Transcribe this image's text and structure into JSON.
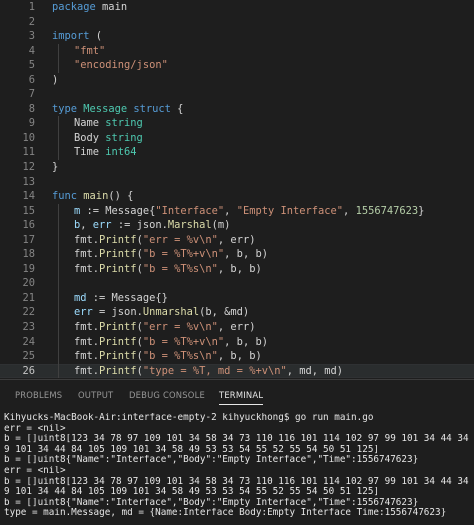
{
  "editor": {
    "current_line": 26,
    "lines": [
      {
        "num": "1",
        "indent": 0,
        "tokens": [
          [
            "keyword",
            "package"
          ],
          [
            "plain",
            " main"
          ]
        ]
      },
      {
        "num": "2",
        "indent": 0,
        "tokens": []
      },
      {
        "num": "3",
        "indent": 0,
        "tokens": [
          [
            "keyword",
            "import"
          ],
          [
            "plain",
            " ("
          ]
        ]
      },
      {
        "num": "4",
        "indent": 1,
        "tokens": [
          [
            "string",
            "\"fmt\""
          ]
        ]
      },
      {
        "num": "5",
        "indent": 1,
        "tokens": [
          [
            "string",
            "\"encoding/json\""
          ]
        ]
      },
      {
        "num": "6",
        "indent": 0,
        "tokens": [
          [
            "plain",
            ")"
          ]
        ]
      },
      {
        "num": "7",
        "indent": 0,
        "tokens": []
      },
      {
        "num": "8",
        "indent": 0,
        "tokens": [
          [
            "keyword",
            "type"
          ],
          [
            "plain",
            " "
          ],
          [
            "type",
            "Message"
          ],
          [
            "plain",
            " "
          ],
          [
            "keyword",
            "struct"
          ],
          [
            "plain",
            " {"
          ]
        ]
      },
      {
        "num": "9",
        "indent": 1,
        "tokens": [
          [
            "plain",
            "Name "
          ],
          [
            "type",
            "string"
          ]
        ]
      },
      {
        "num": "10",
        "indent": 1,
        "tokens": [
          [
            "plain",
            "Body "
          ],
          [
            "type",
            "string"
          ]
        ]
      },
      {
        "num": "11",
        "indent": 1,
        "tokens": [
          [
            "plain",
            "Time "
          ],
          [
            "type",
            "int64"
          ]
        ]
      },
      {
        "num": "12",
        "indent": 0,
        "tokens": [
          [
            "plain",
            "}"
          ]
        ]
      },
      {
        "num": "13",
        "indent": 0,
        "tokens": []
      },
      {
        "num": "14",
        "indent": 0,
        "tokens": [
          [
            "keyword",
            "func"
          ],
          [
            "plain",
            " "
          ],
          [
            "func",
            "main"
          ],
          [
            "plain",
            "() {"
          ]
        ]
      },
      {
        "num": "15",
        "indent": 1,
        "tokens": [
          [
            "var",
            "m"
          ],
          [
            "plain",
            " := Message{"
          ],
          [
            "string",
            "\"Interface\""
          ],
          [
            "plain",
            ", "
          ],
          [
            "string",
            "\"Empty Interface\""
          ],
          [
            "plain",
            ", "
          ],
          [
            "number",
            "1556747623"
          ],
          [
            "plain",
            "}"
          ]
        ]
      },
      {
        "num": "16",
        "indent": 1,
        "tokens": [
          [
            "var",
            "b"
          ],
          [
            "plain",
            ", "
          ],
          [
            "var",
            "err"
          ],
          [
            "plain",
            " := json."
          ],
          [
            "func",
            "Marshal"
          ],
          [
            "plain",
            "(m)"
          ]
        ]
      },
      {
        "num": "17",
        "indent": 1,
        "tokens": [
          [
            "plain",
            "fmt."
          ],
          [
            "func",
            "Printf"
          ],
          [
            "plain",
            "("
          ],
          [
            "string",
            "\"err = %v\\n\""
          ],
          [
            "plain",
            ", err)"
          ]
        ]
      },
      {
        "num": "18",
        "indent": 1,
        "tokens": [
          [
            "plain",
            "fmt."
          ],
          [
            "func",
            "Printf"
          ],
          [
            "plain",
            "("
          ],
          [
            "string",
            "\"b = %T%+v\\n\""
          ],
          [
            "plain",
            ", b, b)"
          ]
        ]
      },
      {
        "num": "19",
        "indent": 1,
        "tokens": [
          [
            "plain",
            "fmt."
          ],
          [
            "func",
            "Printf"
          ],
          [
            "plain",
            "("
          ],
          [
            "string",
            "\"b = %T%s\\n\""
          ],
          [
            "plain",
            ", b, b)"
          ]
        ]
      },
      {
        "num": "20",
        "indent": 1,
        "tokens": []
      },
      {
        "num": "21",
        "indent": 1,
        "tokens": [
          [
            "var",
            "md"
          ],
          [
            "plain",
            " := Message{}"
          ]
        ]
      },
      {
        "num": "22",
        "indent": 1,
        "tokens": [
          [
            "var",
            "err"
          ],
          [
            "plain",
            " = json."
          ],
          [
            "func",
            "Unmarshal"
          ],
          [
            "plain",
            "(b, &md)"
          ]
        ]
      },
      {
        "num": "23",
        "indent": 1,
        "tokens": [
          [
            "plain",
            "fmt."
          ],
          [
            "func",
            "Printf"
          ],
          [
            "plain",
            "("
          ],
          [
            "string",
            "\"err = %v\\n\""
          ],
          [
            "plain",
            ", err)"
          ]
        ]
      },
      {
        "num": "24",
        "indent": 1,
        "tokens": [
          [
            "plain",
            "fmt."
          ],
          [
            "func",
            "Printf"
          ],
          [
            "plain",
            "("
          ],
          [
            "string",
            "\"b = %T%+v\\n\""
          ],
          [
            "plain",
            ", b, b)"
          ]
        ]
      },
      {
        "num": "25",
        "indent": 1,
        "tokens": [
          [
            "plain",
            "fmt."
          ],
          [
            "func",
            "Printf"
          ],
          [
            "plain",
            "("
          ],
          [
            "string",
            "\"b = %T%s\\n\""
          ],
          [
            "plain",
            ", b, b)"
          ]
        ]
      },
      {
        "num": "26",
        "indent": 1,
        "tokens": [
          [
            "plain",
            "fmt."
          ],
          [
            "func",
            "Printf"
          ],
          [
            "plain",
            "("
          ],
          [
            "string",
            "\"type = %T, md = %+v\\n\""
          ],
          [
            "plain",
            ", md, md)"
          ]
        ]
      },
      {
        "num": "27",
        "indent": 0,
        "tokens": [
          [
            "plain",
            "}"
          ]
        ]
      }
    ]
  },
  "panel": {
    "tabs": [
      {
        "label": "PROBLEMS",
        "active": false
      },
      {
        "label": "OUTPUT",
        "active": false
      },
      {
        "label": "DEBUG CONSOLE",
        "active": false
      },
      {
        "label": "TERMINAL",
        "active": true
      }
    ]
  },
  "terminal": {
    "lines": [
      "Kihyucks-MacBook-Air:interface-empty-2 kihyuckhong$ go run main.go",
      "err = <nil>",
      "b = []uint8[123 34 78 97 109 101 34 58 34 73 110 116 101 114 102 97 99 101 34 44 34",
      "9 101 34 44 84 105 109 101 34 58 49 53 53 54 55 52 55 54 50 51 125]",
      "b = []uint8{\"Name\":\"Interface\",\"Body\":\"Empty Interface\",\"Time\":1556747623}",
      "err = <nil>",
      "b = []uint8[123 34 78 97 109 101 34 58 34 73 110 116 101 114 102 97 99 101 34 44 34",
      "9 101 34 44 84 105 109 101 34 58 49 53 53 54 55 52 55 54 50 51 125]",
      "b = []uint8{\"Name\":\"Interface\",\"Body\":\"Empty Interface\",\"Time\":1556747623}",
      "type = main.Message, md = {Name:Interface Body:Empty Interface Time:1556747623}"
    ]
  },
  "colors": {
    "background": "#1e1e1e",
    "keyword": "#569cd6",
    "string": "#ce9178",
    "type": "#4ec9b0",
    "number": "#b5cea8",
    "function": "#dcdcaa",
    "variable": "#9cdcfe",
    "active_tab": "#e7e7e7",
    "inactive_tab": "#969696"
  }
}
